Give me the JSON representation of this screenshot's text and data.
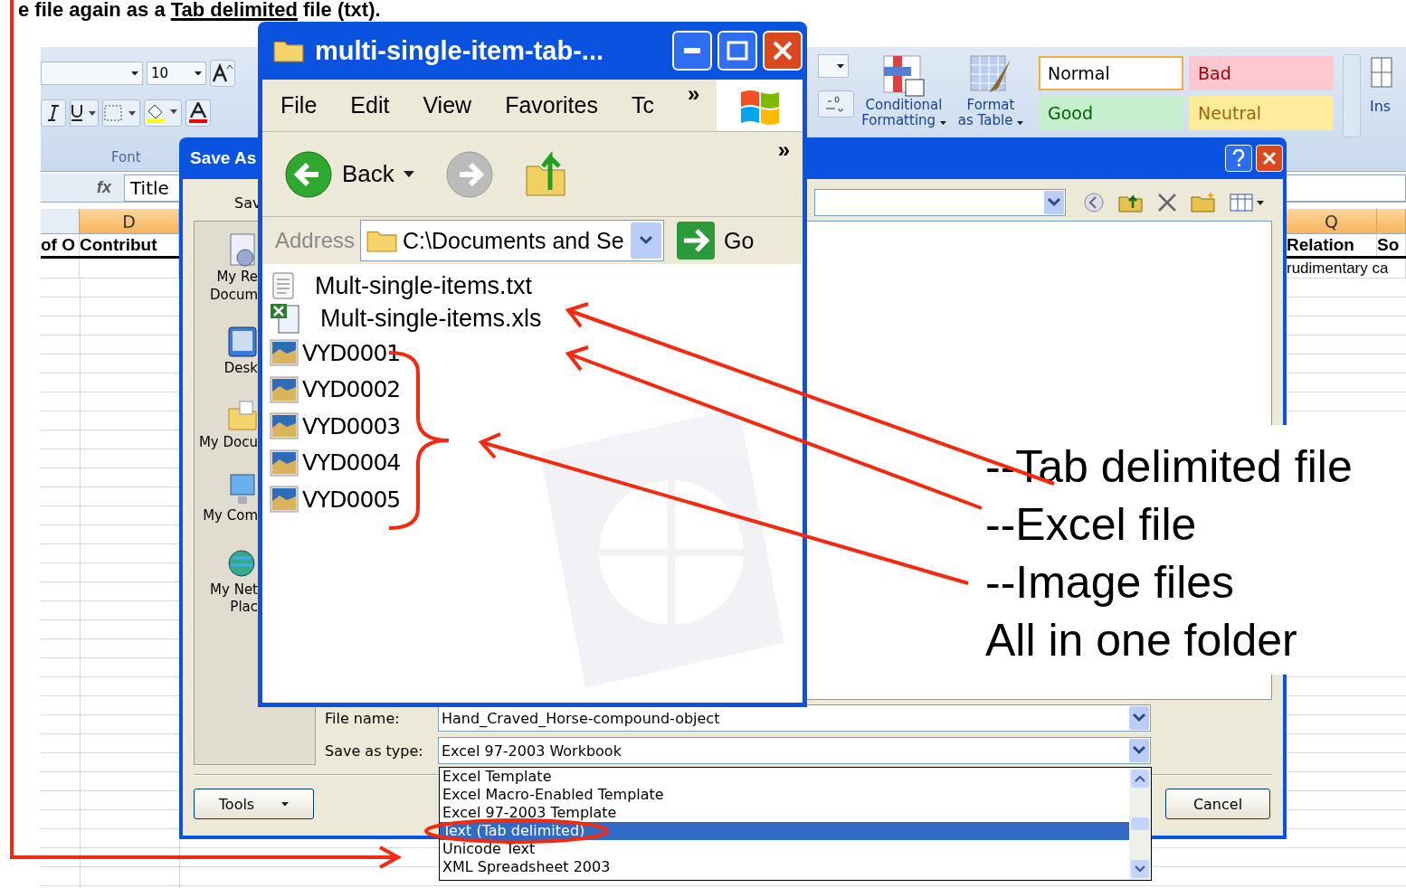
{
  "slide_heading": {
    "before": "e file again as a ",
    "underlined": "Tab delimited",
    "after": " file (txt)."
  },
  "excel": {
    "ribbon": {
      "font_size": "10",
      "font_group_label": "Font",
      "conditional_formatting": [
        "Conditional",
        "Formatting"
      ],
      "format_as_table": [
        "Format",
        "as Table"
      ],
      "cell_styles": [
        {
          "label": "Normal",
          "kind": "normal",
          "selected": true
        },
        {
          "label": "Bad",
          "kind": "bad",
          "selected": false
        },
        {
          "label": "Good",
          "kind": "good",
          "selected": false
        },
        {
          "label": "Neutral",
          "kind": "neutral",
          "selected": false
        }
      ],
      "insert_label": "Ins"
    },
    "formula_bar": {
      "function_label": "fx",
      "value": "Title"
    },
    "columns": [
      {
        "label": "D"
      },
      {
        "label": "Q"
      }
    ],
    "header_cells": [
      "of O",
      "Contribut",
      "Relation",
      "So"
    ],
    "first_row_cell": "rudimentary ca"
  },
  "save_as_dialog": {
    "title": "Save As",
    "save_in_label": "Sav",
    "places": [
      {
        "kind": "recent",
        "lines": [
          "My Re",
          "Docum"
        ]
      },
      {
        "kind": "desktop",
        "lines": [
          "Desk"
        ]
      },
      {
        "kind": "documents",
        "lines": [
          "My Docu"
        ]
      },
      {
        "kind": "computer",
        "lines": [
          "My Com"
        ]
      },
      {
        "kind": "network",
        "lines": [
          "My Net",
          "Plac"
        ]
      }
    ],
    "file_name_label": "File name:",
    "file_name": "Hand_Craved_Horse-compound-object",
    "save_as_type_label": "Save as type:",
    "save_as_type": "Excel 97-2003 Workbook",
    "type_options": [
      {
        "label": "Excel Template",
        "selected": false
      },
      {
        "label": "Excel Macro-Enabled Template",
        "selected": false
      },
      {
        "label": "Excel 97-2003 Template",
        "selected": false
      },
      {
        "label": "Text (Tab delimited)",
        "selected": true
      },
      {
        "label": "Unicode Text",
        "selected": false
      },
      {
        "label": "XML Spreadsheet 2003",
        "selected": false
      }
    ],
    "tools_button": "Tools",
    "cancel_button": "Cancel"
  },
  "explorer": {
    "title": "multi-single-item-tab-...",
    "menu": [
      "File",
      "Edit",
      "View",
      "Favorites",
      "Tc"
    ],
    "menu_overflow": "»",
    "toolbar_overflow": "»",
    "back": "Back",
    "address_label": "Address",
    "address": "C:\\Documents and Se",
    "go": "Go",
    "files": [
      {
        "name": "Mult-single-items.txt",
        "kind": "text"
      },
      {
        "name": "Mult-single-items.xls",
        "kind": "excel"
      },
      {
        "name": "VYD0001",
        "kind": "image"
      },
      {
        "name": "VYD0002",
        "kind": "image"
      },
      {
        "name": "VYD0003",
        "kind": "image"
      },
      {
        "name": "VYD0004",
        "kind": "image"
      },
      {
        "name": "VYD0005",
        "kind": "image"
      }
    ]
  },
  "annotations": [
    "--Tab delimited file",
    "--Excel file",
    "--Image files",
    "All in one folder"
  ]
}
